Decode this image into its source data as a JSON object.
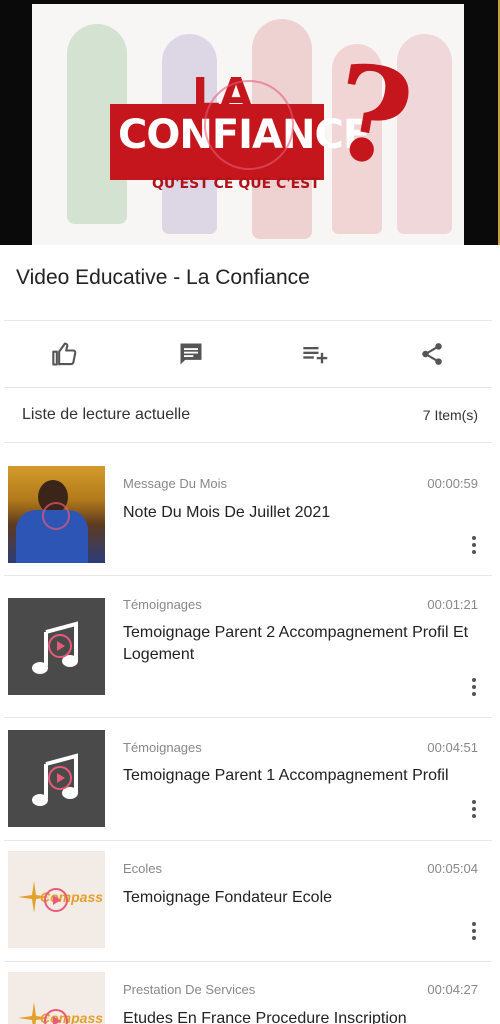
{
  "video": {
    "thumb_title_line1": "LA",
    "thumb_title_line2": "CONFIANCE",
    "thumb_subtitle": "QU'EST CE QUE C'EST",
    "thumb_mark": "?"
  },
  "video_title": "Video Educative - La Confiance",
  "actions": [
    "like-icon",
    "comment-icon",
    "add-to-playlist-icon",
    "share-icon"
  ],
  "playlist": {
    "label": "Liste de lecture actuelle",
    "count": "7 Item(s)"
  },
  "items": [
    {
      "category": "Message Du Mois",
      "duration": "00:00:59",
      "title": "Note Du Mois De Juillet 2021",
      "thumb": "portrait"
    },
    {
      "category": "Témoignages",
      "duration": "00:01:21",
      "title": "Temoignage Parent 2 Accompagnement Profil Et Logement",
      "thumb": "music"
    },
    {
      "category": "Témoignages",
      "duration": "00:04:51",
      "title": "Temoignage Parent 1 Accompagnement Profil",
      "thumb": "music"
    },
    {
      "category": "Ecoles",
      "duration": "00:05:04",
      "title": "Temoignage Fondateur Ecole",
      "thumb": "compass",
      "logo_text": "Compass"
    },
    {
      "category": "Prestation De Services",
      "duration": "00:04:27",
      "title": "Etudes En France Procedure Inscription",
      "thumb": "compass",
      "logo_text": "Compass"
    }
  ],
  "colors": {
    "brand_red": "#c4161c",
    "play_pink": "#e85a78"
  }
}
